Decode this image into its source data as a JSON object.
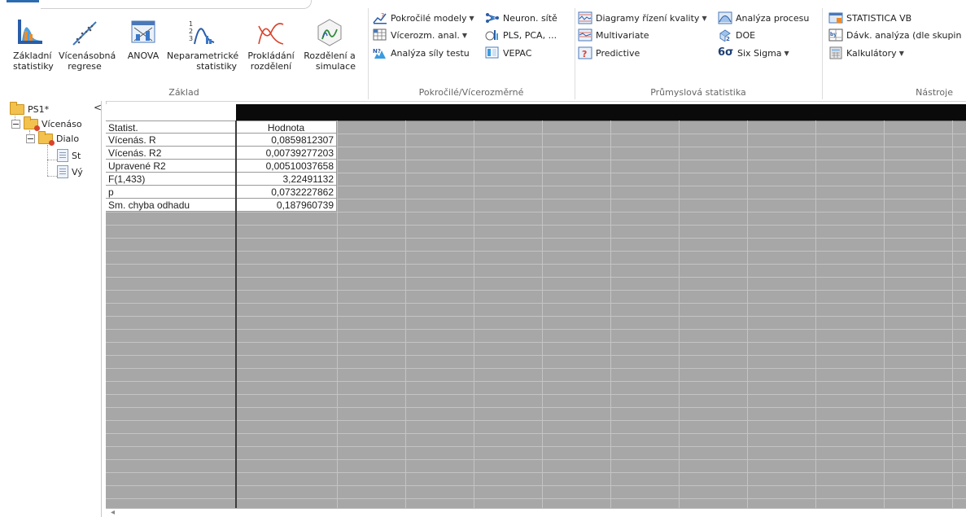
{
  "ribbon": {
    "groups": [
      {
        "label": "Základ"
      },
      {
        "label": "Pokročilé/Vícerozměrné"
      },
      {
        "label": "Průmyslová statistika"
      },
      {
        "label": "Nástroje"
      }
    ],
    "zaklad_buttons": [
      {
        "line1": "Základní",
        "line2": "statistiky"
      },
      {
        "line1": "Vícenásobná",
        "line2": "regrese"
      },
      {
        "line1": "ANOVA",
        "line2": ""
      },
      {
        "line1": "Neparametrické",
        "line2": "statistiky"
      },
      {
        "line1": "Prokládání",
        "line2": "rozdělení"
      },
      {
        "line1": "Rozdělení a",
        "line2": "simulace"
      }
    ],
    "advanced": [
      {
        "label": "Pokročilé modely",
        "dropdown": true
      },
      {
        "label": "Neuron. sítě",
        "dropdown": false
      },
      {
        "label": "Vícerozm. anal.",
        "dropdown": true
      },
      {
        "label": "PLS, PCA, ...",
        "dropdown": false
      },
      {
        "label": "Analýza síly testu",
        "dropdown": false
      },
      {
        "label": "VEPAC",
        "dropdown": false
      }
    ],
    "industrial": [
      {
        "label": "Diagramy řízení kvality",
        "dropdown": true
      },
      {
        "label": "Analýza procesu",
        "dropdown": false
      },
      {
        "label": "Multivariate",
        "dropdown": false
      },
      {
        "label": "DOE",
        "dropdown": false
      },
      {
        "label": "Predictive",
        "dropdown": false
      },
      {
        "label": "Six Sigma",
        "dropdown": true
      }
    ],
    "six_sigma_glyph": "6σ",
    "tools": [
      {
        "label": "STATISTICA VB"
      },
      {
        "label": "Dávk. analýza (dle skupin"
      },
      {
        "label": "Kalkulátory"
      }
    ]
  },
  "tree": {
    "collapse_glyph": "<",
    "items": [
      {
        "label": "PS1*"
      },
      {
        "label": "Vícenáso"
      },
      {
        "label": "Dialo"
      },
      {
        "label": "St"
      },
      {
        "label": "Vý"
      }
    ]
  },
  "table": {
    "header": {
      "name": "Statist.",
      "value": "Hodnota"
    },
    "rows": [
      {
        "name": "Vícenás. R",
        "value": "0,0859812307"
      },
      {
        "name": "Vícenás. R2",
        "value": "0,00739277203"
      },
      {
        "name": "Upravené R2",
        "value": "0,00510037658"
      },
      {
        "name": "F(1,433)",
        "value": "3,22491132"
      },
      {
        "name": "p",
        "value": "0,0732227862"
      },
      {
        "name": "Sm. chyba odhadu",
        "value": "0,187960739"
      }
    ]
  },
  "colors": {
    "accent": "#2b6cb0",
    "grid_bg": "#a7a7a7",
    "header_bar": "#0a0a0a"
  }
}
